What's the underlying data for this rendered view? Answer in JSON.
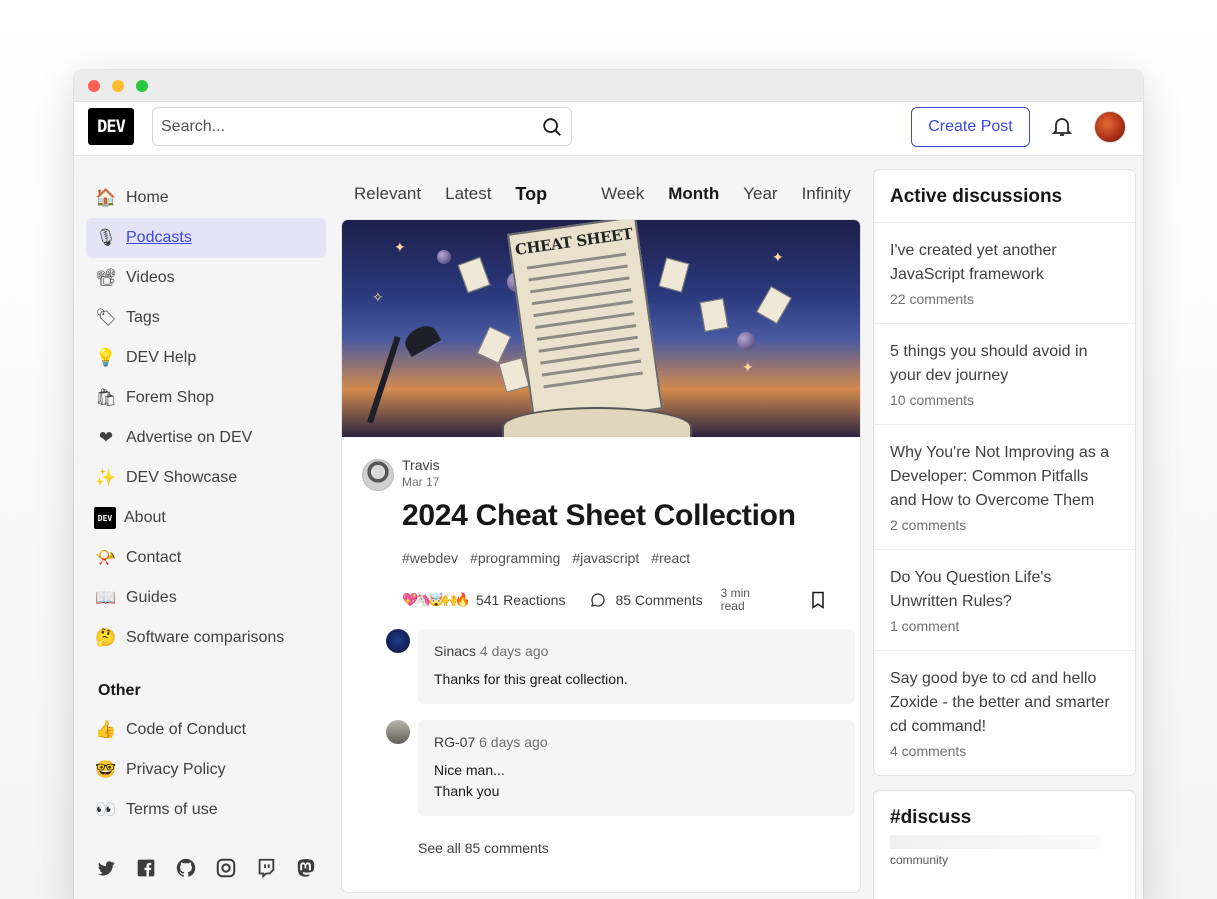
{
  "header": {
    "logo": "DEV",
    "search_placeholder": "Search...",
    "create_post": "Create Post"
  },
  "sidebar": {
    "items": [
      {
        "label": "Home",
        "icon": "🏠"
      },
      {
        "label": "Podcasts",
        "icon": "🎙"
      },
      {
        "label": "Videos",
        "icon": "📽"
      },
      {
        "label": "Tags",
        "icon": "🏷"
      },
      {
        "label": "DEV Help",
        "icon": "💡"
      },
      {
        "label": "Forem Shop",
        "icon": "🛍"
      },
      {
        "label": "Advertise on DEV",
        "icon": "❤"
      },
      {
        "label": "DEV Showcase",
        "icon": "✨"
      },
      {
        "label": "About",
        "icon": "DEV"
      },
      {
        "label": "Contact",
        "icon": "📯"
      },
      {
        "label": "Guides",
        "icon": "📖"
      },
      {
        "label": "Software comparisons",
        "icon": "🤔"
      }
    ],
    "other_heading": "Other",
    "other_items": [
      {
        "label": "Code of Conduct",
        "icon": "👍"
      },
      {
        "label": "Privacy Policy",
        "icon": "🤓"
      },
      {
        "label": "Terms of use",
        "icon": "👀"
      }
    ],
    "socials": [
      "twitter-icon",
      "facebook-icon",
      "github-icon",
      "instagram-icon",
      "twitch-icon",
      "mastodon-icon"
    ]
  },
  "feed": {
    "tabs": [
      "Relevant",
      "Latest",
      "Top"
    ],
    "periods": [
      "Week",
      "Month",
      "Year",
      "Infinity"
    ],
    "active_tab": "Top",
    "active_period": "Month"
  },
  "post": {
    "cover_text": "CHEAT SHEET",
    "author": "Travis",
    "date": "Mar 17",
    "title": "2024 Cheat Sheet Collection",
    "tags": [
      "#webdev",
      "#programming",
      "#javascript",
      "#react"
    ],
    "reaction_emojis": "💖🦄🤯🙌🔥",
    "reactions": "541 Reactions",
    "comments": "85 Comments",
    "read_time": "3 min read",
    "comment_list": [
      {
        "user": "Sinacs",
        "time": "4 days ago",
        "text": "Thanks for this great collection."
      },
      {
        "user": "RG-07",
        "time": "6 days ago",
        "text": "Nice man...\nThank you"
      }
    ],
    "see_all": "See all 85 comments"
  },
  "right": {
    "active_title": "Active discussions",
    "discussions": [
      {
        "title": "I've created yet another JavaScript framework",
        "count": "22 comments"
      },
      {
        "title": "5 things you should avoid in your dev journey",
        "count": "10 comments"
      },
      {
        "title": "Why You're Not Improving as a Developer: Common Pitfalls and How to Overcome Them",
        "count": "2 comments"
      },
      {
        "title": "Do You Question Life's Unwritten Rules?",
        "count": "1 comment"
      },
      {
        "title": "Say good bye to cd and hello Zoxide - the better and smarter cd command!",
        "count": "4 comments"
      }
    ],
    "discuss_title": "#discuss",
    "discuss_sub": "community"
  },
  "colors": {
    "accent": "#3b49df",
    "active_nav_bg": "#e4e4f6"
  }
}
